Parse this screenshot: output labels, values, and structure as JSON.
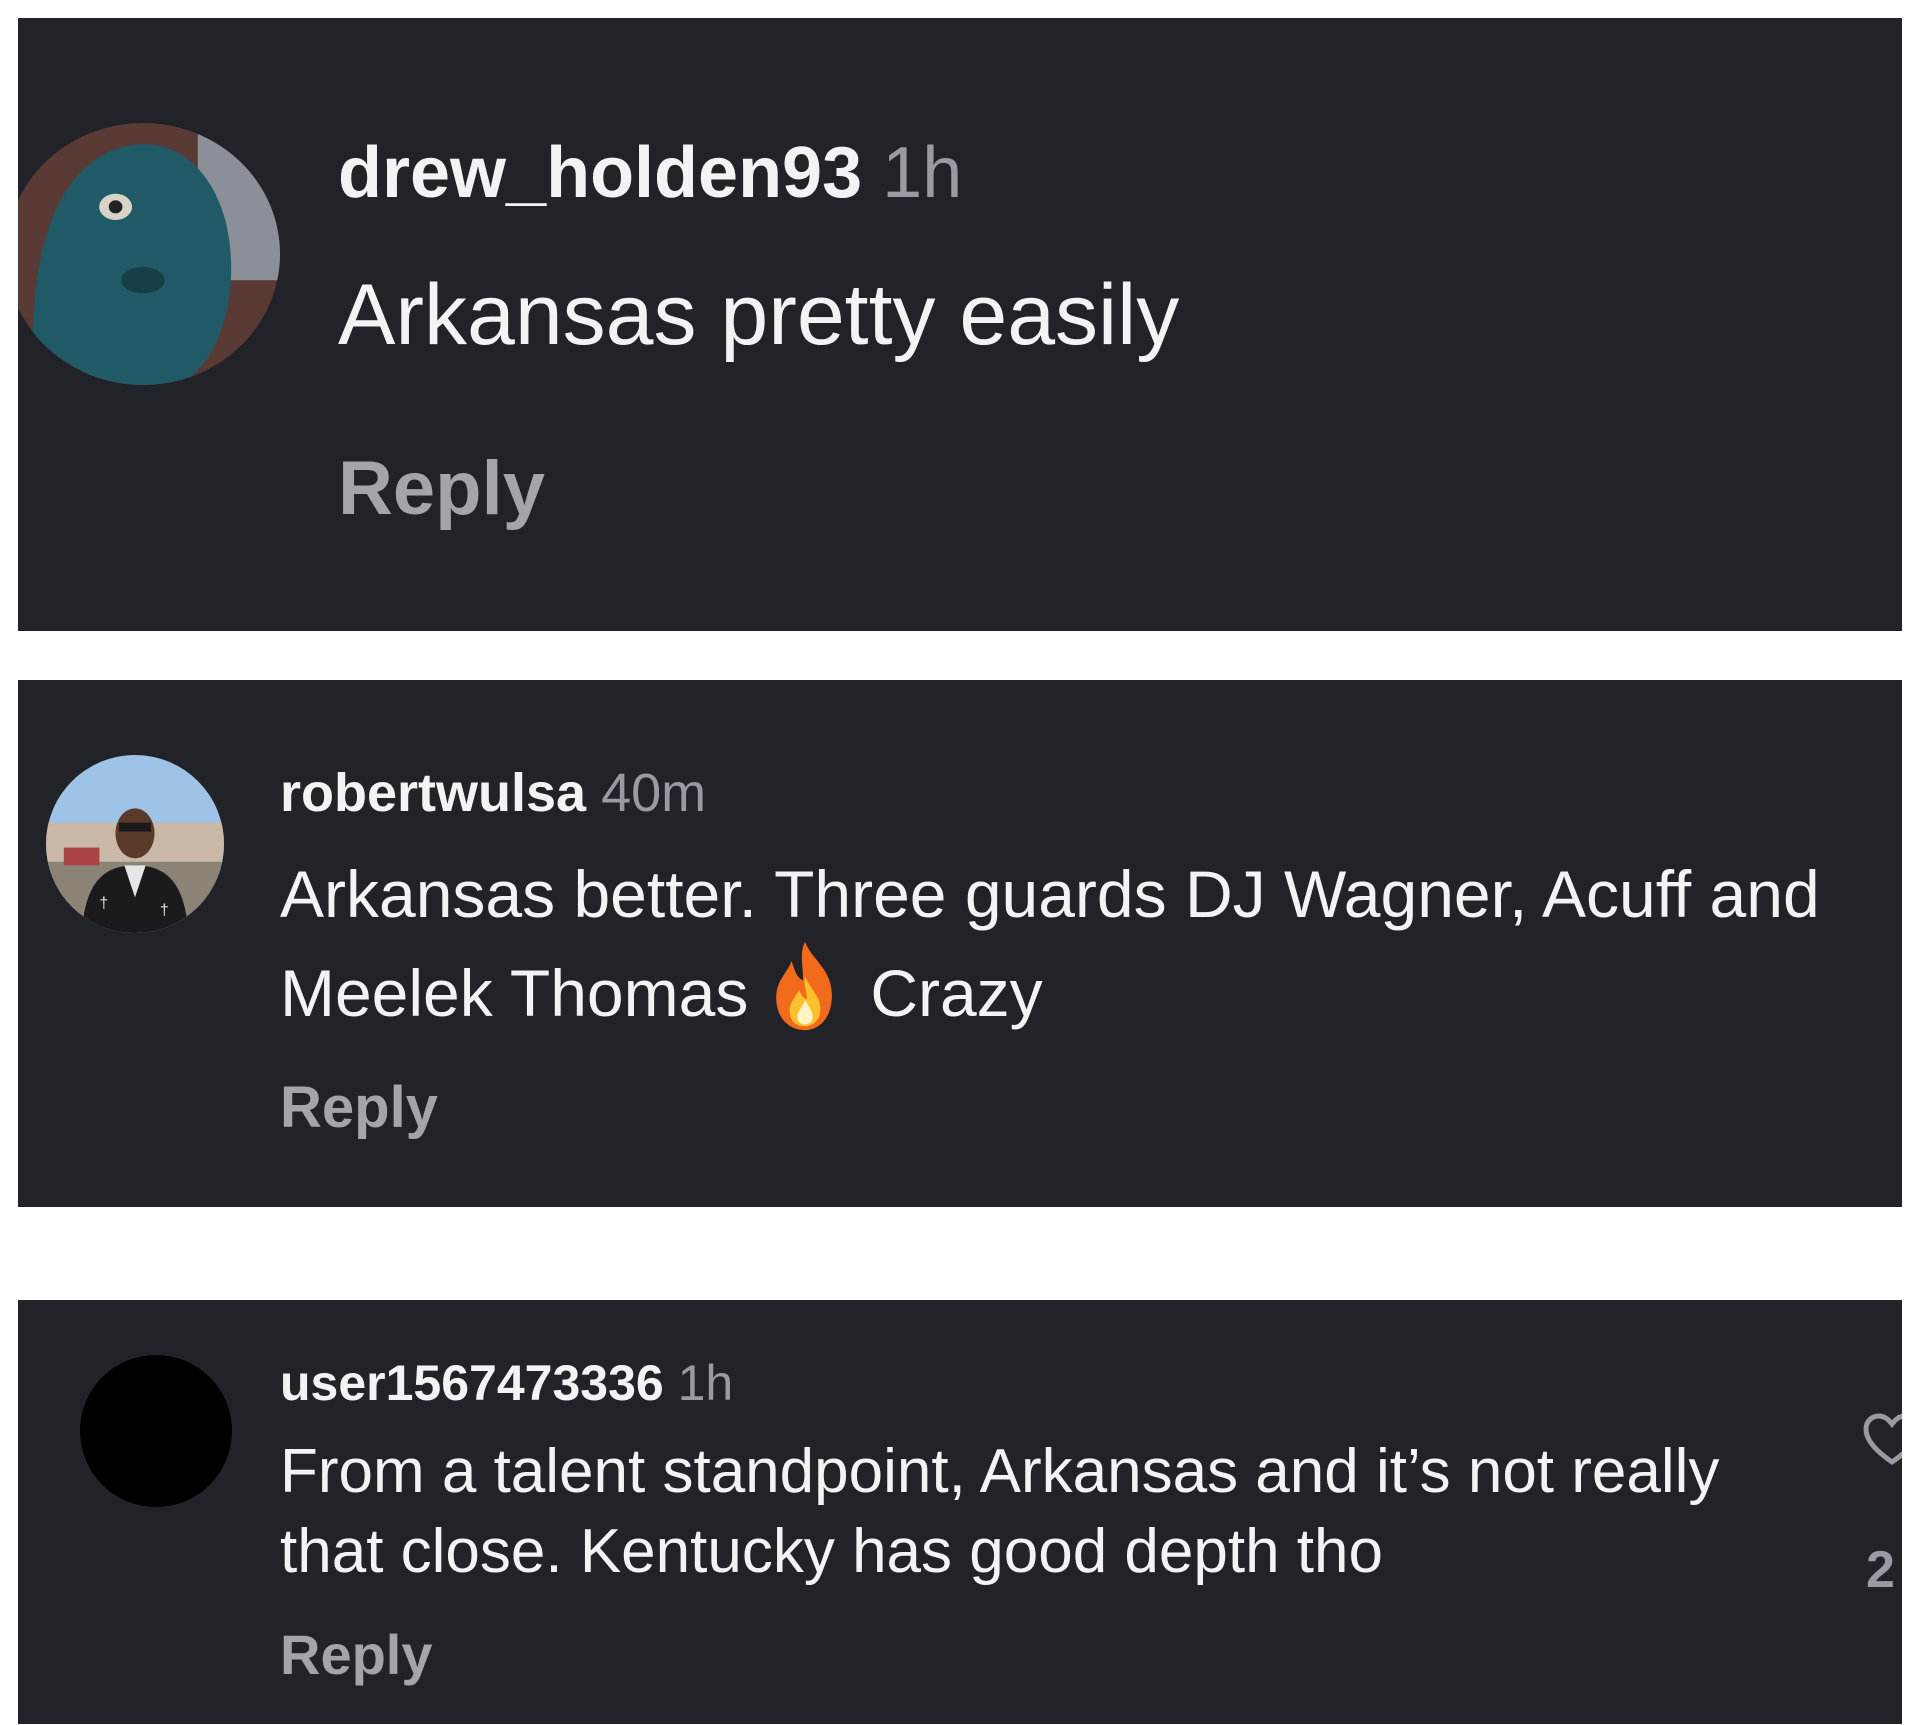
{
  "comments": [
    {
      "username": "drew_holden93",
      "time": "1h",
      "text": "Arkansas pretty easily",
      "reply_label": "Reply"
    },
    {
      "username": "robertwulsa",
      "time": "40m",
      "text_before_emoji": "Arkansas better. Three guards DJ Wagner, Acuff and Meelek Thomas",
      "text_after_emoji": "Crazy",
      "emoji": "fire-emoji",
      "reply_label": "Reply"
    },
    {
      "username": "user1567473336",
      "time": "1h",
      "text": "From a talent standpoint, Arkansas and it’s not really that close. Kentucky has good depth tho",
      "reply_label": "Reply",
      "like_count": "2",
      "like_icon": "heart-icon"
    }
  ],
  "colors": {
    "panel_background": "#222328",
    "page_background": "#ffffff",
    "text_primary": "#f3f3f5",
    "text_secondary": "#9a9ba2"
  }
}
